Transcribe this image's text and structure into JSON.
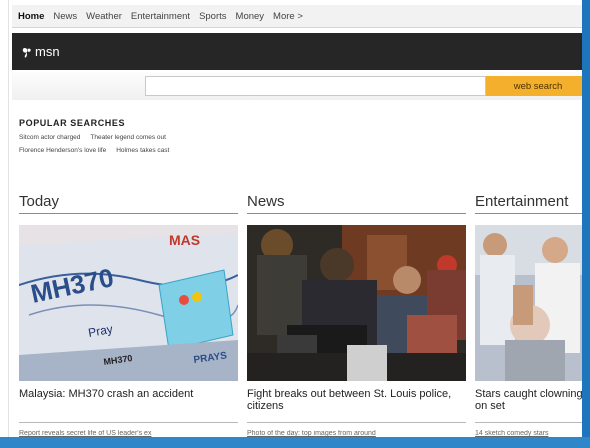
{
  "nav": {
    "items": [
      "Home",
      "News",
      "Weather",
      "Entertainment",
      "Sports",
      "Money",
      "More >"
    ]
  },
  "header": {
    "logo_text": "msn",
    "logo_icon": "butterfly-icon"
  },
  "search": {
    "value": "",
    "button_label": "web search"
  },
  "popular": {
    "title": "POPULAR SEARCHES",
    "rows": [
      [
        "Sitcom actor charged",
        "Theater legend comes out"
      ],
      [
        "Florence Henderson's love life",
        "Holmes takes cast"
      ]
    ]
  },
  "sections": [
    {
      "title": "Today",
      "caption": "Malaysia: MH370 crash an accident",
      "subcaption": "Report reveals secret life of US leader's ex"
    },
    {
      "title": "News",
      "caption": "Fight breaks out between St. Louis police, citizens",
      "subcaption": "Photo of the day: top images from around"
    },
    {
      "title": "Entertainment",
      "caption": "Stars caught clowning on set",
      "subcaption": "14 sketch comedy stars"
    }
  ],
  "colors": {
    "header_bg": "#262626",
    "search_button": "#f4b02c",
    "window_edge": "#1d75bc"
  }
}
